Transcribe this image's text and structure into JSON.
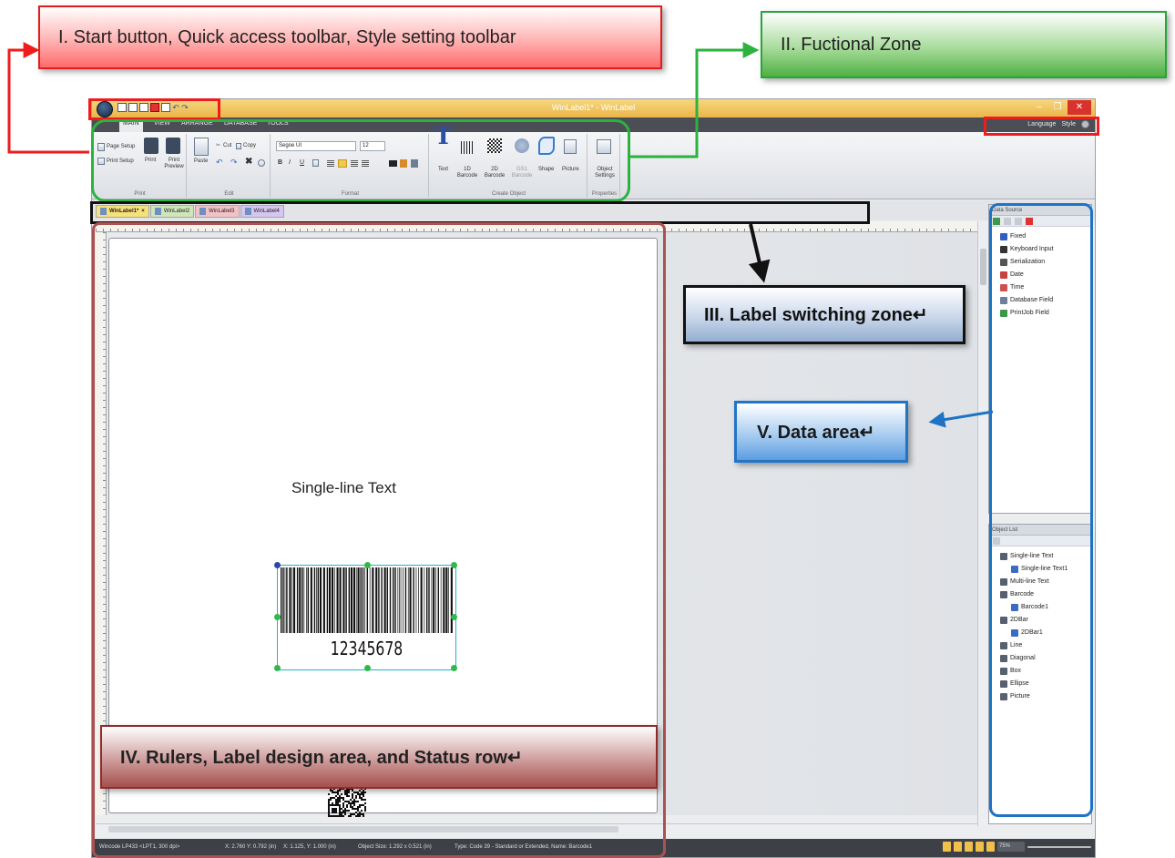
{
  "window": {
    "title": "WinLabel1* - WinLabel",
    "menu_tabs": [
      "MAIN",
      "VIEW",
      "ARRANGE",
      "DATABASE",
      "TOOLS"
    ],
    "language_label": "Language",
    "style_label": "Style"
  },
  "ribbon": {
    "print_group": {
      "name": "Print",
      "page_setup": "Page Setup",
      "print_setup": "Print Setup",
      "print": "Print",
      "print_preview": "Print Preview"
    },
    "edit_group": {
      "name": "Edit",
      "paste": "Paste",
      "cut": "Cut",
      "copy": "Copy"
    },
    "format_group": {
      "name": "Format",
      "font": "Segoe UI",
      "font_size": "12"
    },
    "create_group": {
      "name": "Create Object",
      "text": "Text",
      "barcode_1d": "1D Barcode",
      "barcode_2d": "2D Barcode",
      "gs1": "GS1 Barcode",
      "shape": "Shape",
      "picture": "Picture"
    },
    "properties_group": {
      "name": "Properties",
      "object_settings": "Object Settings"
    }
  },
  "doc_tabs": [
    "WinLabel1*",
    "WinLabel2",
    "WinLabel3",
    "WinLabel4"
  ],
  "label": {
    "single_line_text": "Single-line Text",
    "barcode_value": "12345678"
  },
  "data_source": {
    "title": "Data Source",
    "items": [
      {
        "label": "Fixed",
        "color": "#2f5fbf"
      },
      {
        "label": "Keyboard Input",
        "color": "#333333"
      },
      {
        "label": "Serialization",
        "color": "#555555"
      },
      {
        "label": "Date",
        "color": "#c94040"
      },
      {
        "label": "Time",
        "color": "#d05050"
      },
      {
        "label": "Database Field",
        "color": "#6b7f9a"
      },
      {
        "label": "PrintJob Field",
        "color": "#3a9a4a"
      }
    ]
  },
  "object_list": {
    "title": "Object List",
    "items": [
      {
        "label": "Single-line Text",
        "sub": false
      },
      {
        "label": "Single-line Text1",
        "sub": true
      },
      {
        "label": "Multi-line Text",
        "sub": false
      },
      {
        "label": "Barcode",
        "sub": false
      },
      {
        "label": "Barcode1",
        "sub": true
      },
      {
        "label": "2DBar",
        "sub": false
      },
      {
        "label": "2DBar1",
        "sub": true
      },
      {
        "label": "Line",
        "sub": false
      },
      {
        "label": "Diagonal",
        "sub": false
      },
      {
        "label": "Box",
        "sub": false
      },
      {
        "label": "Ellipse",
        "sub": false
      },
      {
        "label": "Picture",
        "sub": false
      }
    ]
  },
  "status_bar": {
    "printer": "Wincode LP433 <LPT1, 300 dpi>",
    "cursor": "X: 2.760 Y: 0.792 (in)",
    "position": "X: 1.125, Y: 1.000 (in)",
    "object_size": "Object Size: 1.292 x 0.521 (in)",
    "type": "Type: Code 39 - Standard or Extended, Name: Barcode1",
    "zoom": "75%"
  },
  "annotations": {
    "zone1": "I. Start button, Quick access toolbar, Style setting toolbar",
    "zone2": "II. Fuctional Zone",
    "zone3": "III. Label switching zone↵",
    "zone4": "IV. Rulers, Label design area, and Status row↵",
    "zone5": "V. Data area↵"
  },
  "colors": {
    "zone1": "#ee1c1c",
    "zone2": "#2bb23f",
    "zone3": "#111111",
    "zone4": "#a85352",
    "zone5": "#1e73c4"
  }
}
